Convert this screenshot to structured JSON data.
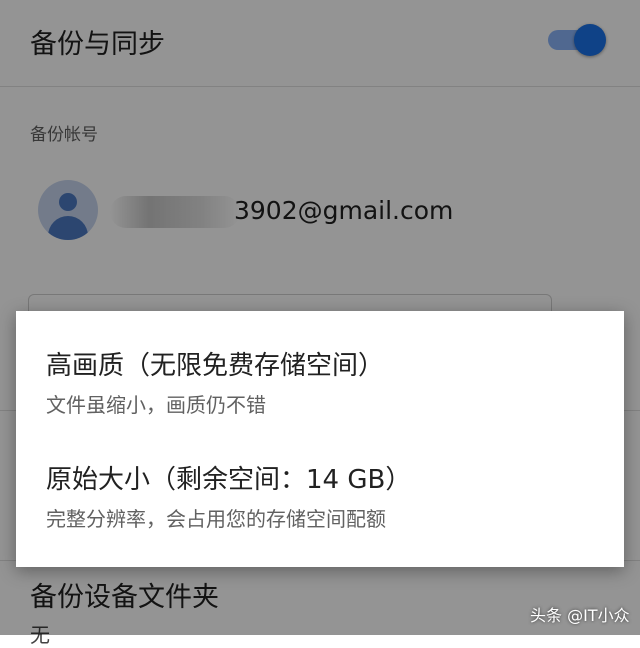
{
  "settings": {
    "backup_sync_title": "备份与同步",
    "backup_account_label": "备份帐号",
    "account_email_visible": "3902@gmail.com",
    "backup_device_folders_title": "备份设备文件夹",
    "backup_device_folders_value": "无",
    "toggle_on": true
  },
  "dialog": {
    "options": [
      {
        "title": "高画质（无限免费存储空间）",
        "description": "文件虽缩小，画质仍不错"
      },
      {
        "title": "原始大小（剩余空间：14 GB）",
        "description": "完整分辨率，会占用您的存储空间配额"
      }
    ]
  },
  "watermark": "头条 @IT小众",
  "colors": {
    "accent": "#1a73e8",
    "toggle_track": "#8ab4f8",
    "scrim": "rgba(0,0,0,0.42)"
  },
  "icons": {
    "avatar": "account-circle-icon"
  }
}
